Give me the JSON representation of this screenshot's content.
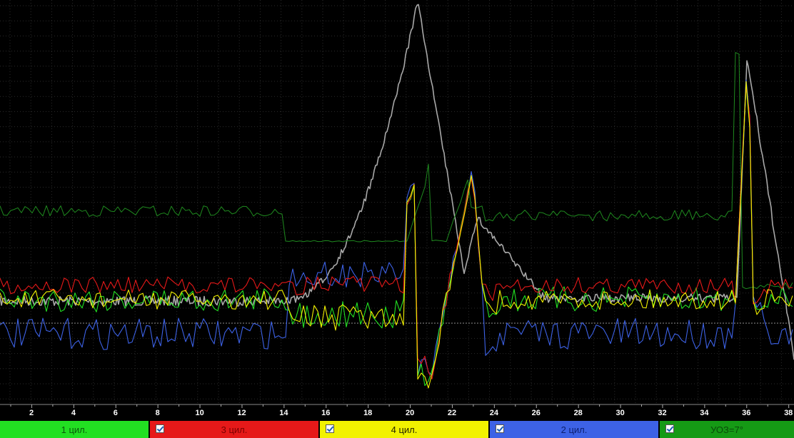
{
  "axis": {
    "x_ticks": [
      "2",
      "4",
      "6",
      "8",
      "10",
      "12",
      "14",
      "16",
      "18",
      "20",
      "22",
      "24",
      "26",
      "28",
      "30",
      "32",
      "34",
      "36",
      "38"
    ]
  },
  "channels": [
    {
      "label": "1 цил.",
      "color": "#22e022",
      "text_color": "#0a5a0a",
      "checked": false
    },
    {
      "label": "3 цил.",
      "color": "#e61919",
      "text_color": "#7a0000",
      "checked": true
    },
    {
      "label": "4 цил.",
      "color": "#f2f200",
      "text_color": "#222200",
      "checked": true
    },
    {
      "label": "2 цил.",
      "color": "#3d62e6",
      "text_color": "#0c1e6e",
      "checked": true
    },
    {
      "label": "УОЗ=7°",
      "color": "#159a15",
      "text_color": "#0a4a0a",
      "checked": true
    }
  ],
  "trace_colors": {
    "grid": "#2b2b2b",
    "pressure": "#a8a8a8",
    "dark_green": "#1f8a1f",
    "baseline": "#8a8a8a"
  }
}
